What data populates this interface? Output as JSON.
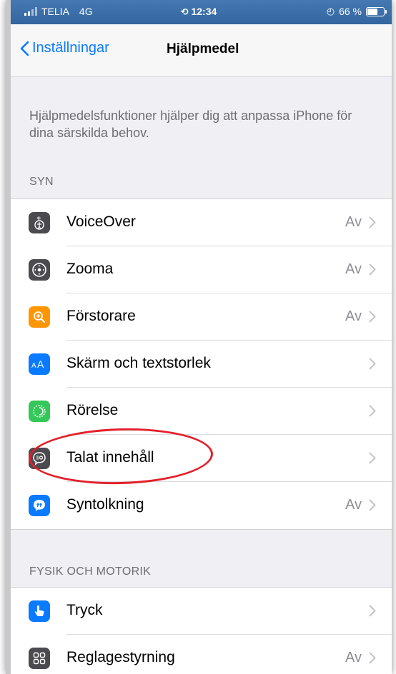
{
  "status_bar": {
    "carrier": "TELIA",
    "network": "4G",
    "time": "12:34",
    "battery": "66 %",
    "battery_level": 0.66
  },
  "nav": {
    "back_label": "Inställningar",
    "title": "Hjälpmedel"
  },
  "description": "Hjälpmedelsfunktioner hjälper dig att anpassa iPhone för dina särskilda behov.",
  "sections": [
    {
      "header": "SYN",
      "items": [
        {
          "label": "VoiceOver",
          "value": "Av",
          "icon": "voiceover-icon",
          "color": "#4a4a4f"
        },
        {
          "label": "Zooma",
          "value": "Av",
          "icon": "zoom-icon",
          "color": "#4a4a4f"
        },
        {
          "label": "Förstorare",
          "value": "Av",
          "icon": "magnifier-icon",
          "color": "#ff9500"
        },
        {
          "label": "Skärm och textstorlek",
          "value": "",
          "icon": "text-size-icon",
          "color": "#0a7aff"
        },
        {
          "label": "Rörelse",
          "value": "",
          "icon": "motion-icon",
          "color": "#34c759"
        },
        {
          "label": "Talat innehåll",
          "value": "",
          "icon": "speech-icon",
          "color": "#4a4a4f"
        },
        {
          "label": "Syntolkning",
          "value": "Av",
          "icon": "audio-description-icon",
          "color": "#0a7aff"
        }
      ]
    },
    {
      "header": "FYSIK OCH MOTORIK",
      "items": [
        {
          "label": "Tryck",
          "value": "",
          "icon": "touch-icon",
          "color": "#0a7aff"
        },
        {
          "label": "Reglagestyrning",
          "value": "Av",
          "icon": "switch-control-icon",
          "color": "#4a4a4f"
        }
      ]
    }
  ],
  "highlight_color": "#e3202a"
}
